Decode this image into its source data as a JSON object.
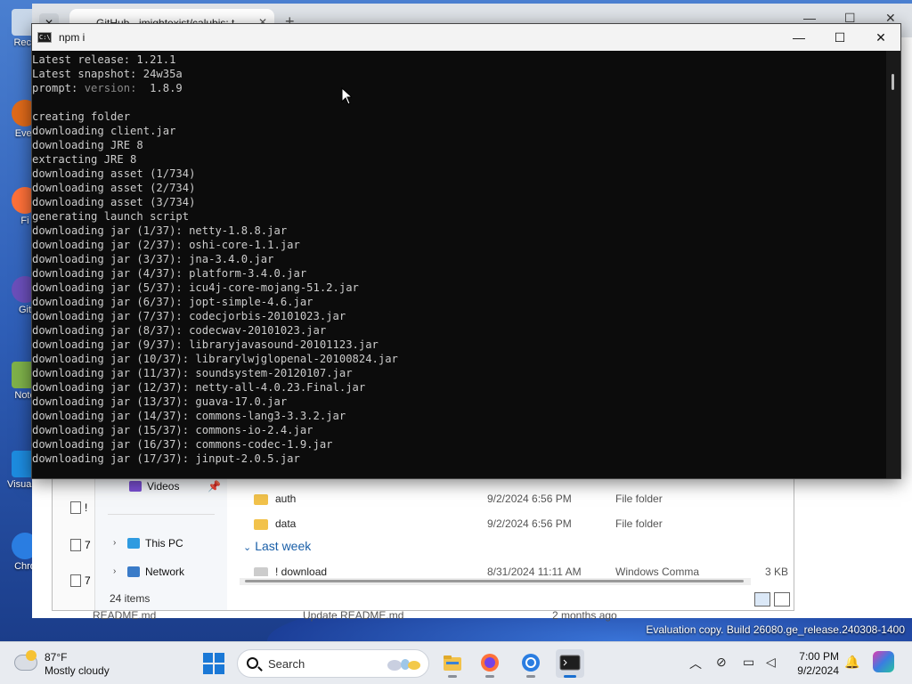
{
  "browser": {
    "tab_title": "GitHub - imightexist/calubis: t",
    "bottom_row": {
      "name": "README.md",
      "commit": "Update README.md",
      "age": "2 months ago"
    }
  },
  "desktop": {
    "icons": [
      {
        "label": "Recy"
      },
      {
        "label": "Ever"
      },
      {
        "label": "Fi"
      },
      {
        "label": "Git"
      },
      {
        "label": "Note"
      },
      {
        "label": "Visual C"
      },
      {
        "label": "Chro"
      }
    ],
    "evaluation_text": "Evaluation copy. Build 26080.ge_release.240308-1400"
  },
  "explorer": {
    "nav": [
      {
        "label": "Videos"
      },
      {
        "label": "This PC"
      },
      {
        "label": "Network"
      }
    ],
    "left_files": [
      {
        "label": "!"
      },
      {
        "label": "7"
      },
      {
        "label": "7"
      }
    ],
    "files": [
      {
        "name": "auth",
        "date": "9/2/2024 6:56 PM",
        "type": "File folder",
        "size": ""
      },
      {
        "name": "data",
        "date": "9/2/2024 6:56 PM",
        "type": "File folder",
        "size": ""
      }
    ],
    "group_label": "Last week",
    "partial_file": {
      "name": "! download",
      "date": "8/31/2024 11:11 AM",
      "type": "Windows Comma",
      "size": "3 KB"
    },
    "item_count": "24 items"
  },
  "terminal": {
    "title": "npm i",
    "lines": [
      {
        "text": "Latest release: 1.21.1"
      },
      {
        "text": "Latest snapshot: 24w35a"
      },
      {
        "text": "prompt: ",
        "dim": "version: ",
        "rest": " 1.8.9"
      },
      {
        "text": ""
      },
      {
        "text": "creating folder"
      },
      {
        "text": "downloading client.jar"
      },
      {
        "text": "downloading JRE 8"
      },
      {
        "text": "extracting JRE 8"
      },
      {
        "text": "downloading asset (1/734)"
      },
      {
        "text": "downloading asset (2/734)"
      },
      {
        "text": "downloading asset (3/734)"
      },
      {
        "text": "generating launch script"
      },
      {
        "text": "downloading jar (1/37): netty-1.8.8.jar"
      },
      {
        "text": "downloading jar (2/37): oshi-core-1.1.jar"
      },
      {
        "text": "downloading jar (3/37): jna-3.4.0.jar"
      },
      {
        "text": "downloading jar (4/37): platform-3.4.0.jar"
      },
      {
        "text": "downloading jar (5/37): icu4j-core-mojang-51.2.jar"
      },
      {
        "text": "downloading jar (6/37): jopt-simple-4.6.jar"
      },
      {
        "text": "downloading jar (7/37): codecjorbis-20101023.jar"
      },
      {
        "text": "downloading jar (8/37): codecwav-20101023.jar"
      },
      {
        "text": "downloading jar (9/37): libraryjavasound-20101123.jar"
      },
      {
        "text": "downloading jar (10/37): librarylwjglopenal-20100824.jar"
      },
      {
        "text": "downloading jar (11/37): soundsystem-20120107.jar"
      },
      {
        "text": "downloading jar (12/37): netty-all-4.0.23.Final.jar"
      },
      {
        "text": "downloading jar (13/37): guava-17.0.jar"
      },
      {
        "text": "downloading jar (14/37): commons-lang3-3.3.2.jar"
      },
      {
        "text": "downloading jar (15/37): commons-io-2.4.jar"
      },
      {
        "text": "downloading jar (16/37): commons-codec-1.9.jar"
      },
      {
        "text": "downloading jar (17/37): jinput-2.0.5.jar"
      }
    ]
  },
  "taskbar": {
    "weather": {
      "temp": "87°F",
      "condition": "Mostly cloudy"
    },
    "search_label": "Search",
    "apps": [
      {
        "name": "file-explorer-icon"
      },
      {
        "name": "firefox-icon"
      },
      {
        "name": "chrome-icon"
      },
      {
        "name": "terminal-icon",
        "active": true
      }
    ],
    "clock": {
      "time": "7:00 PM",
      "date": "9/2/2024"
    }
  }
}
